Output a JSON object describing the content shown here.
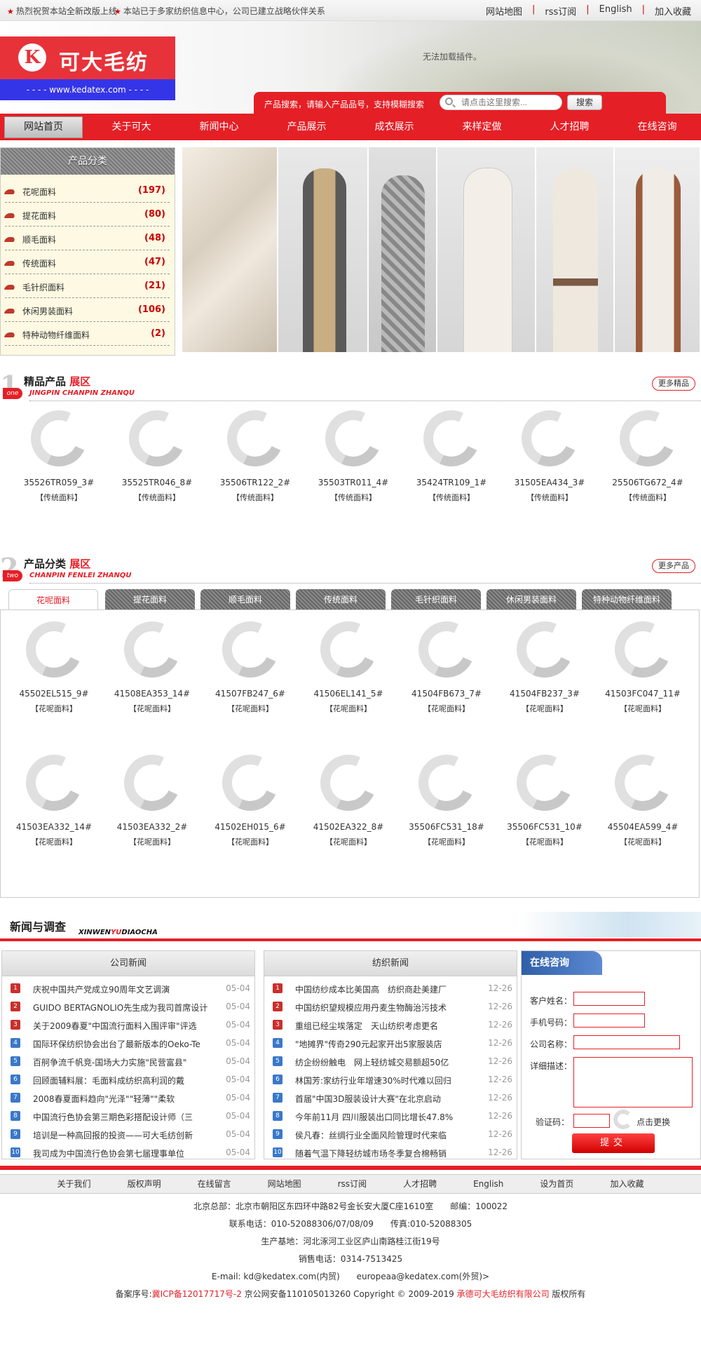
{
  "topbar": {
    "notice1": "热烈祝贺本站全新改版上线",
    "notice2": "本站已于多家纺织信息中心，公司已建立战略伙伴关系",
    "links": [
      "网站地图",
      "rss订阅",
      "English",
      "加入收藏"
    ]
  },
  "header": {
    "logo_mark": "K",
    "logo_text": "可大毛纺",
    "logo_url": "- - - - www.kedatex.com - - - -",
    "plugin_msg": "无法加载插件。",
    "search_label": "产品搜索，请输入产品品号，支持模糊搜索",
    "search_placeholder": "请点击这里搜索...",
    "search_button": "搜索"
  },
  "nav": [
    "网站首页",
    "关于可大",
    "新闻中心",
    "产品展示",
    "成衣展示",
    "来样定做",
    "人才招聘",
    "在线咨询"
  ],
  "categories": {
    "title": "产品分类",
    "items": [
      {
        "name": "花呢面料",
        "count": "(197)"
      },
      {
        "name": "提花面料",
        "count": "(80)"
      },
      {
        "name": "顺毛面料",
        "count": "(48)"
      },
      {
        "name": "传统面料",
        "count": "(47)"
      },
      {
        "name": "毛针织面料",
        "count": "(21)"
      },
      {
        "name": "休闲男装面料",
        "count": "(106)"
      },
      {
        "name": "特种动物纤维面料",
        "count": "(2)"
      }
    ]
  },
  "featured": {
    "num": "1",
    "badge": "one",
    "title": "精品产品",
    "title_red": "展区",
    "subtitle": "JINGPIN CHANPIN ZHANQU",
    "more": "更多精品",
    "products": [
      {
        "code": "35526TR059_3#",
        "cat": "【传统面料】"
      },
      {
        "code": "35525TR046_8#",
        "cat": "【传统面料】"
      },
      {
        "code": "35506TR122_2#",
        "cat": "【传统面料】"
      },
      {
        "code": "35503TR011_4#",
        "cat": "【传统面料】"
      },
      {
        "code": "35424TR109_1#",
        "cat": "【传统面料】"
      },
      {
        "code": "31505EA434_3#",
        "cat": "【传统面料】"
      },
      {
        "code": "25506TG672_4#",
        "cat": "【传统面料】"
      }
    ]
  },
  "category_zone": {
    "num": "2",
    "badge": "two",
    "title": "产品分类",
    "title_red": "展区",
    "subtitle": "CHANPIN FENLEI ZHANQU",
    "more": "更多产品",
    "tabs": [
      "花呢面料",
      "提花面料",
      "顺毛面料",
      "传统面料",
      "毛针织面料",
      "休闲男装面料",
      "特种动物纤维面料"
    ],
    "products": [
      {
        "code": "45502EL515_9#",
        "cat": "【花呢面料】"
      },
      {
        "code": "41508EA353_14#",
        "cat": "【花呢面料】"
      },
      {
        "code": "41507FB247_6#",
        "cat": "【花呢面料】"
      },
      {
        "code": "41506EL141_5#",
        "cat": "【花呢面料】"
      },
      {
        "code": "41504FB673_7#",
        "cat": "【花呢面料】"
      },
      {
        "code": "41504FB237_3#",
        "cat": "【花呢面料】"
      },
      {
        "code": "41503FC047_11#",
        "cat": "【花呢面料】"
      },
      {
        "code": "41503EA332_14#",
        "cat": "【花呢面料】"
      },
      {
        "code": "41503EA332_2#",
        "cat": "【花呢面料】"
      },
      {
        "code": "41502EH015_6#",
        "cat": "【花呢面料】"
      },
      {
        "code": "41502EA322_8#",
        "cat": "【花呢面料】"
      },
      {
        "code": "35506FC531_18#",
        "cat": "【花呢面料】"
      },
      {
        "code": "35506FC531_10#",
        "cat": "【花呢面料】"
      },
      {
        "code": "45504EA599_4#",
        "cat": "【花呢面料】"
      }
    ]
  },
  "news": {
    "title": "新闻与调查",
    "sub_a": "XINWEN",
    "sub_b": "YU",
    "sub_c": "DIAOCHA",
    "company": {
      "title": "公司新闻",
      "items": [
        {
          "text": "庆祝中国共产党成立90周年文艺调演",
          "date": "05-04"
        },
        {
          "text": "GUIDO BERTAGNOLIO先生成为我司首席设计师",
          "date": "05-04"
        },
        {
          "text": "关于2009春夏\"中国流行面料入围评审\"评选",
          "date": "05-04"
        },
        {
          "text": "国际环保纺织协会出台了最新版本的Oeko-Te",
          "date": "05-04"
        },
        {
          "text": "百舸争流千帆竞-国场大力实施\"民营富县\"",
          "date": "05-04"
        },
        {
          "text": "回顾面辅料展：毛面料成纺织高利润的戴",
          "date": "05-04"
        },
        {
          "text": "2008春夏面料趋向\"光泽\"\"轻薄\"\"柔软",
          "date": "05-04"
        },
        {
          "text": "中国流行色协会第三期色彩搭配设计师（三",
          "date": "05-04"
        },
        {
          "text": "培训是一种高回报的投资——可大毛纺创新",
          "date": "05-04"
        },
        {
          "text": "我司成为中国流行色协会第七届理事单位",
          "date": "05-04"
        }
      ]
    },
    "industry": {
      "title": "纺织新闻",
      "items": [
        {
          "text": "中国纺纱成本比美国高　纺织商赴美建厂",
          "date": "12-26"
        },
        {
          "text": "中国纺织望规模应用丹麦生物酶治污技术",
          "date": "12-26"
        },
        {
          "text": "重组已经尘埃落定　天山纺织考虑更名",
          "date": "12-26"
        },
        {
          "text": "\"地摊界\"传奇290元起家开出5家服装店",
          "date": "12-26"
        },
        {
          "text": "纺企纷纷触电　网上轻纺城交易额超50亿",
          "date": "12-26"
        },
        {
          "text": "林国芳:家纺行业年增速30%时代难以回归",
          "date": "12-26"
        },
        {
          "text": "首届\"中国3D服装设计大赛\"在北京启动",
          "date": "12-26"
        },
        {
          "text": "今年前11月 四川服装出口同比增长47.8%",
          "date": "12-26"
        },
        {
          "text": "侯凡春：丝绸行业全面风险管理时代来临",
          "date": "12-26"
        },
        {
          "text": "随着气温下降轻纺城市场冬季复合棉畅销",
          "date": "12-26"
        }
      ]
    }
  },
  "consult": {
    "title": "在线咨询",
    "name_label": "客户姓名：",
    "phone_label": "手机号码：",
    "company_label": "公司名称：",
    "desc_label": "详细描述：",
    "captcha_label": "验证码：",
    "captcha_change": "点击更换",
    "submit": "提交"
  },
  "footer": {
    "links": [
      "关于我们",
      "版权声明",
      "在线留言",
      "网站地图",
      "rss订阅",
      "人才招聘",
      "English",
      "设为首页",
      "加入收藏"
    ],
    "address": "北京总部：北京市朝阳区东四环中路82号金长安大厦C座1610室　　邮编：100022",
    "phone": "联系电话：010-52088306/07/08/09　　传真:010-52088305",
    "factory": "生产基地：河北涿河工业区庐山南路桂江街19号",
    "sales": "销售电话：0314-7513425",
    "email": "E-mail: kd@kedatex.com(内贸)　　europeaa@kedatex.com(外贸)>",
    "icp_prefix": "备案序号:",
    "icp": "冀ICP备12017717号-2",
    "copyright_mid": " 京公网安备110105013260 Copyright © 2009-2019 ",
    "company_name": "承德可大毛纺织有限公司",
    "copyright_end": " 版权所有"
  }
}
